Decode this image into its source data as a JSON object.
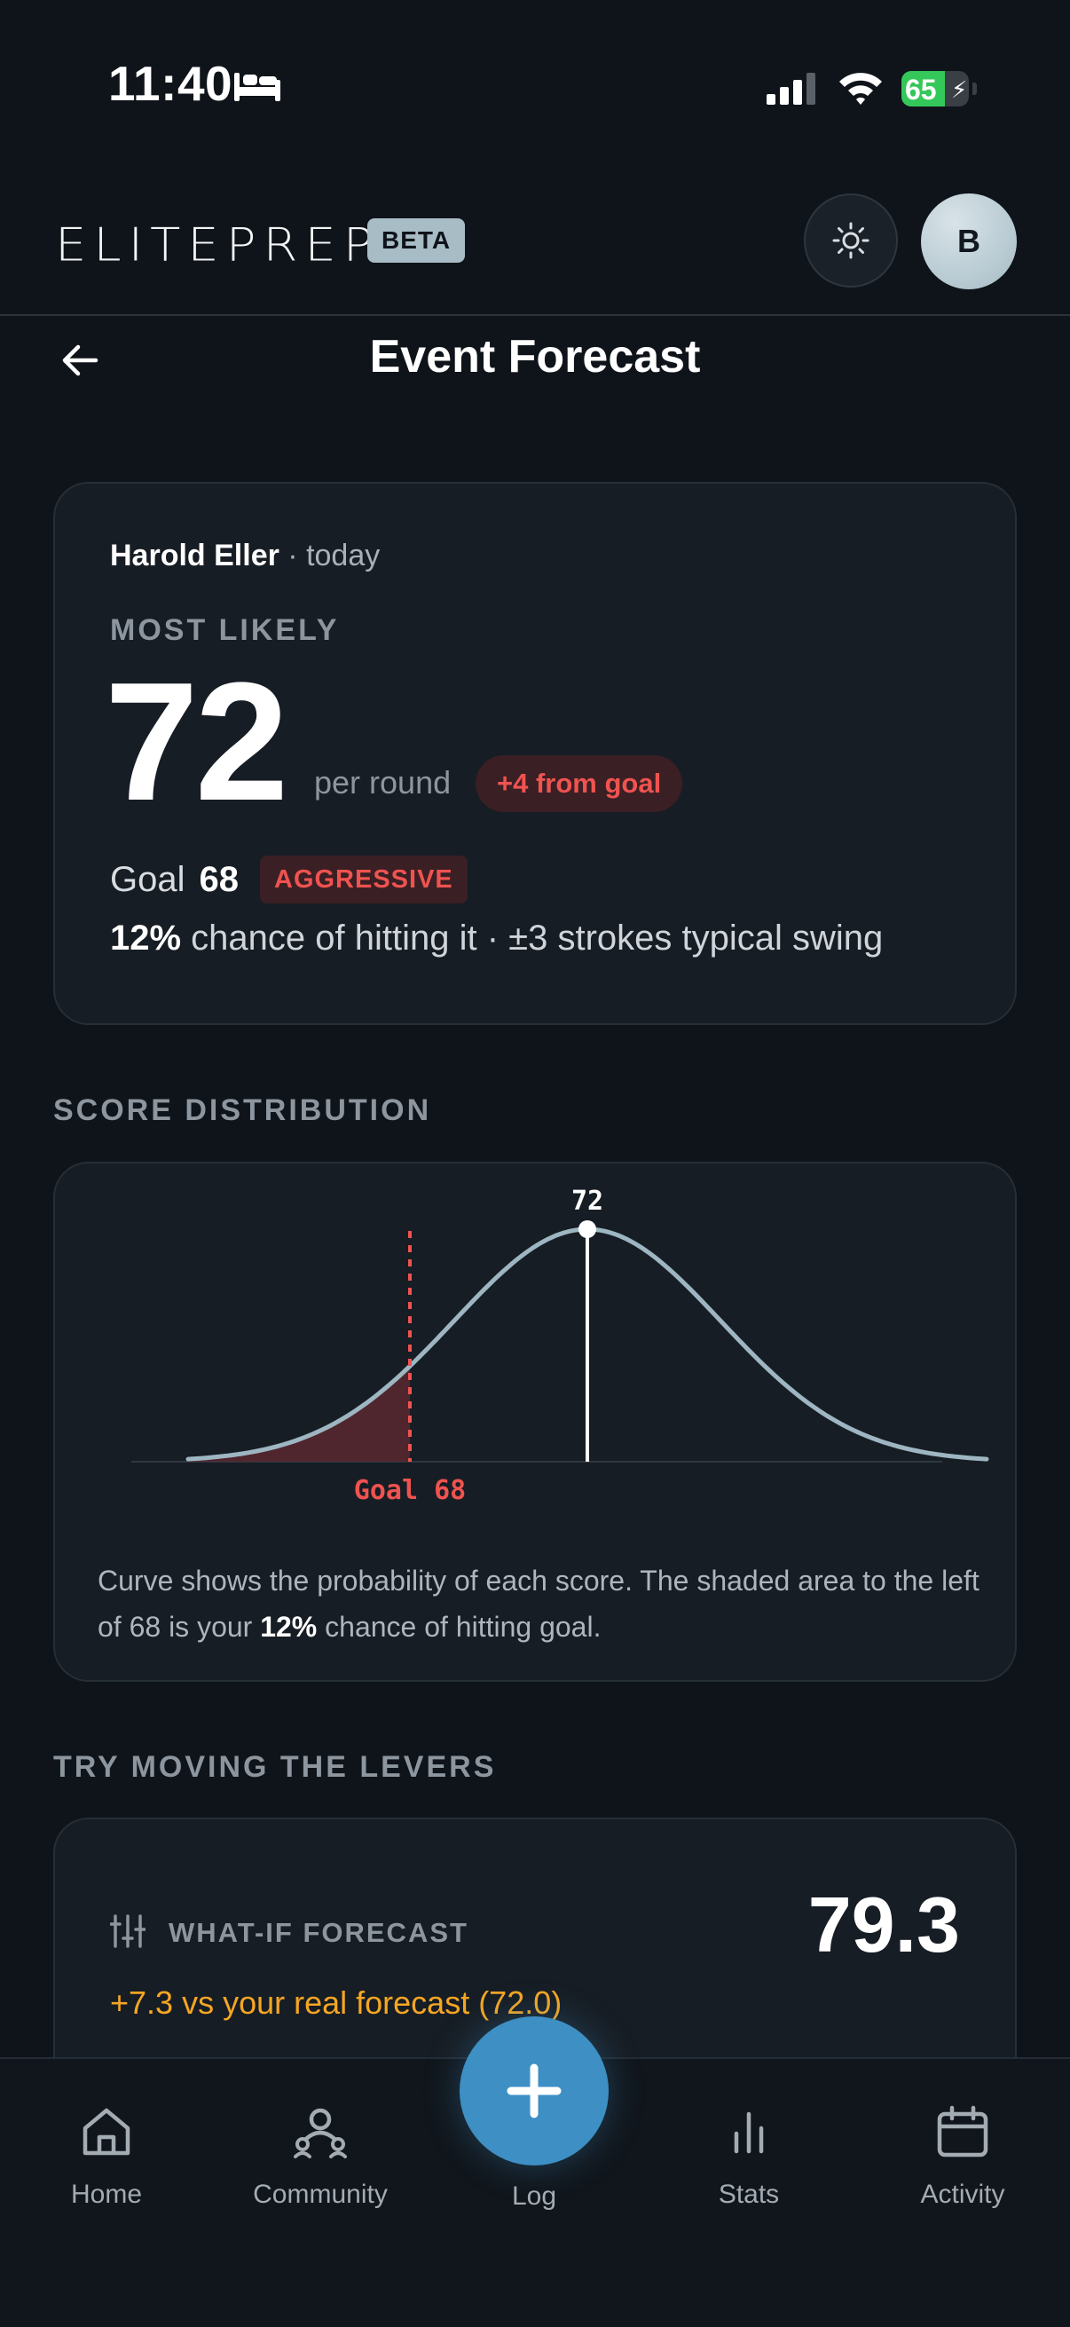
{
  "status_bar": {
    "time": "11:40",
    "battery_level": "65",
    "battery_fraction": 0.65,
    "battery_color": "#34c759"
  },
  "header": {
    "logo": "ELITEPREP",
    "badge": "BETA",
    "theme_icon": "sun-icon",
    "avatar_initial": "B"
  },
  "page": {
    "title": "Event Forecast",
    "back_icon": "arrow-left-icon"
  },
  "forecast": {
    "player_name": "Harold Eller",
    "separator": " · ",
    "date": "today",
    "most_likely_label": "MOST LIKELY",
    "score": "72",
    "unit": "per round",
    "delta_badge": "+4 from goal",
    "goal_label": "Goal",
    "goal_value": "68",
    "goal_tag": "AGGRESSIVE",
    "chance_pct": "12%",
    "chance_text": " chance of hitting it · ±3 strokes typical swing"
  },
  "distribution": {
    "section_label": "SCORE DISTRIBUTION",
    "caption_before": "Curve shows the probability of each score. The shaded area to the left of 68 is your ",
    "caption_pct": "12%",
    "caption_after": " chance of hitting goal."
  },
  "chart_data": {
    "type": "area",
    "curve": "normal distribution",
    "mean": 72,
    "sd": 3,
    "x_range": [
      63,
      81
    ],
    "peak_label": "72",
    "goal_value": 68,
    "goal_label": "Goal 68",
    "shaded_region": "left of 68",
    "curve_color": "#9db6c2",
    "goal_color": "#ef5350",
    "shade_color": "#5a2830",
    "mean_line_color": "#ffffff"
  },
  "levers": {
    "section_label": "TRY MOVING THE LEVERS",
    "icon": "sliders-icon",
    "whatif_label": "WHAT-IF FORECAST",
    "whatif_value": "79.3",
    "whatif_delta": "+7.3 vs your real forecast (72.0)"
  },
  "bottom_nav": {
    "items": [
      {
        "label": "Home",
        "icon": "home-icon"
      },
      {
        "label": "Community",
        "icon": "community-icon"
      },
      {
        "label": "Log",
        "icon": "plus-icon"
      },
      {
        "label": "Stats",
        "icon": "bar-chart-icon"
      },
      {
        "label": "Activity",
        "icon": "calendar-icon"
      }
    ]
  },
  "colors": {
    "background": "#0f141a",
    "card": "#171d24",
    "accent_red": "#ef5350",
    "accent_orange": "#f5a623",
    "log_button": "#3d8fc4"
  }
}
